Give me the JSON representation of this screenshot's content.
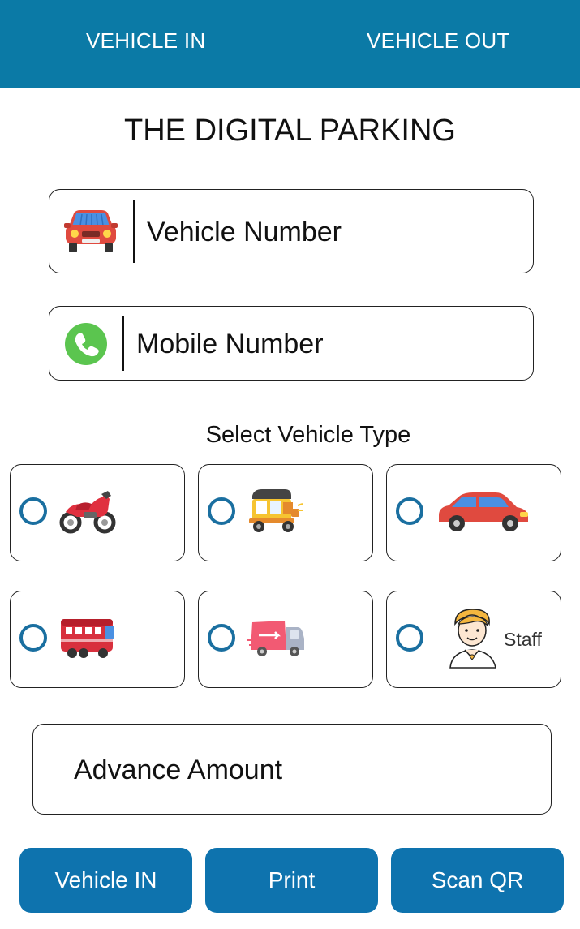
{
  "topbar": {
    "tabs": [
      {
        "label": "VEHICLE IN"
      },
      {
        "label": "VEHICLE OUT"
      }
    ],
    "bg_color": "#0b7aa6"
  },
  "title": "THE DIGITAL PARKING",
  "form": {
    "vehicle_number": {
      "placeholder": "Vehicle Number",
      "value": "",
      "icon": "car-icon"
    },
    "mobile_number": {
      "placeholder": "Mobile Number",
      "value": "",
      "icon": "phone-icon"
    },
    "advance_amount": {
      "placeholder": "Advance Amount",
      "value": ""
    }
  },
  "vehicle_type": {
    "label": "Select Vehicle Type",
    "options": [
      {
        "icon": "motorcycle-icon",
        "selected": false
      },
      {
        "icon": "auto-rickshaw-icon",
        "selected": false
      },
      {
        "icon": "car-icon",
        "selected": false
      },
      {
        "icon": "bus-icon",
        "selected": false
      },
      {
        "icon": "delivery-truck-icon",
        "selected": false
      },
      {
        "icon": "staff-person-icon",
        "label": "Staff",
        "selected": false
      }
    ]
  },
  "buttons": {
    "vehicle_in": "Vehicle IN",
    "print": "Print",
    "scan_qr": "Scan QR"
  },
  "colors": {
    "accent": "#0e73ae",
    "radio": "#1a6fa0"
  }
}
